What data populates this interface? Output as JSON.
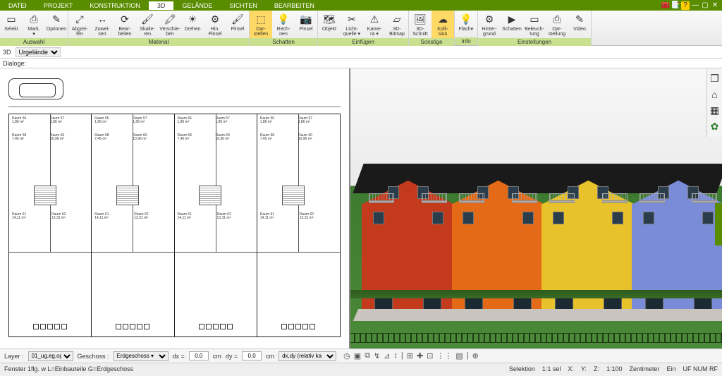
{
  "menu": {
    "tabs": [
      "DATEI",
      "PROJEKT",
      "KONSTRUKTION",
      "3D",
      "GELÄNDE",
      "SICHTEN",
      "BEARBEITEN"
    ],
    "active_index": 3
  },
  "ribbon": {
    "groups": [
      {
        "label": "Auswahl",
        "items": [
          {
            "l1": "Selekt",
            "l2": ""
          },
          {
            "l1": "Mark.",
            "l2": "▾"
          },
          {
            "l1": "Optionen",
            "l2": ""
          }
        ]
      },
      {
        "label": "Material",
        "items": [
          {
            "l1": "Abgrei-",
            "l2": "fen"
          },
          {
            "l1": "Zuwei-",
            "l2": "sen"
          },
          {
            "l1": "Bear-",
            "l2": "beiten"
          },
          {
            "l1": "Skalie-",
            "l2": "ren"
          },
          {
            "l1": "Verschie-",
            "l2": "ben"
          },
          {
            "l1": "Drehen",
            "l2": ""
          },
          {
            "l1": "Hin.",
            "l2": "Pinsel"
          },
          {
            "l1": "Pinsel",
            "l2": ""
          }
        ]
      },
      {
        "label": "Schatten",
        "items": [
          {
            "l1": "Dar-",
            "l2": "stellen",
            "hl": true
          },
          {
            "l1": "Rech-",
            "l2": "nen"
          },
          {
            "l1": "Pinsel",
            "l2": ""
          }
        ]
      },
      {
        "label": "Einfügen",
        "items": [
          {
            "l1": "Objekt",
            "l2": ""
          },
          {
            "l1": "Licht-",
            "l2": "quelle ▾"
          },
          {
            "l1": "Kame-",
            "l2": "ra ▾"
          },
          {
            "l1": "3D-",
            "l2": "Bitmap"
          }
        ]
      },
      {
        "label": "Sonstige",
        "items": [
          {
            "l1": "3D-",
            "l2": "Schnitt"
          },
          {
            "l1": "Kolli-",
            "l2": "sion",
            "hl": true
          }
        ]
      },
      {
        "label": "Info",
        "items": [
          {
            "l1": "Fläche",
            "l2": ""
          }
        ]
      },
      {
        "label": "Einstellungen",
        "items": [
          {
            "l1": "Hinter-",
            "l2": "grund"
          },
          {
            "l1": "Schatten",
            "l2": ""
          },
          {
            "l1": "Beleuch-",
            "l2": "tung"
          },
          {
            "l1": "Dar-",
            "l2": "stellung"
          },
          {
            "l1": "Video",
            "l2": ""
          }
        ]
      }
    ]
  },
  "subbar": {
    "label_3d": "3D",
    "dropdown": "Urgelände"
  },
  "dialoge_label": "Dialoge:",
  "plan": {
    "units": [
      {
        "rooms": [
          {
            "n": "Raum 56",
            "a": "1,86 m²"
          },
          {
            "n": "Raum 57",
            "a": "1,86 m²"
          },
          {
            "n": "Raum 58",
            "a": "7,45 m²"
          },
          {
            "n": "Raum 60",
            "a": "10,96 m²"
          },
          {
            "n": "Raum 61",
            "a": "14,11 m²"
          },
          {
            "n": "Raum 62",
            "a": "13,31 m²"
          }
        ]
      },
      {
        "rooms": [
          {
            "n": "Raum 56",
            "a": "1,86 m²"
          },
          {
            "n": "Raum 57",
            "a": "1,86 m²"
          },
          {
            "n": "Raum 58",
            "a": "7,45 m²"
          },
          {
            "n": "Raum 60",
            "a": "10,96 m²"
          },
          {
            "n": "Raum 61",
            "a": "14,11 m²"
          },
          {
            "n": "Raum 62",
            "a": "13,31 m²"
          }
        ]
      },
      {
        "rooms": [
          {
            "n": "Raum 56",
            "a": "1,86 m²"
          },
          {
            "n": "Raum 57",
            "a": "1,86 m²"
          },
          {
            "n": "Raum 58",
            "a": "7,45 m²"
          },
          {
            "n": "Raum 60",
            "a": "10,96 m²"
          },
          {
            "n": "Raum 61",
            "a": "14,11 m²"
          },
          {
            "n": "Raum 62",
            "a": "13,31 m²"
          }
        ]
      },
      {
        "rooms": [
          {
            "n": "Raum 56",
            "a": "1,86 m²"
          },
          {
            "n": "Raum 57",
            "a": "1,86 m²"
          },
          {
            "n": "Raum 58",
            "a": "7,45 m²"
          },
          {
            "n": "Raum 60",
            "a": "10,96 m²"
          },
          {
            "n": "Raum 61",
            "a": "14,11 m²"
          },
          {
            "n": "Raum 62",
            "a": "13,31 m²"
          }
        ]
      }
    ]
  },
  "houses": [
    {
      "c": "h-red"
    },
    {
      "c": "h-orange"
    },
    {
      "c": "h-yellow"
    },
    {
      "c": "h-blue"
    }
  ],
  "ctrl": {
    "layer_label": "Layer :",
    "layer_val": "01_ug,eg,og",
    "geschoss_label": "Geschoss :",
    "geschoss_val": "Erdgeschoss ▾",
    "dx_label": "dx =",
    "dx_val": "0.0",
    "dx_unit": "cm",
    "dy_label": "dy =",
    "dy_val": "0.0",
    "dy_unit": "cm",
    "mode": "dx,dy (relativ ka"
  },
  "status": {
    "left": "Fenster 1flg. w L=Einbauteile G=Erdgeschoss",
    "selektion": "Selektion",
    "sel": "1:1 sel",
    "x": "X:",
    "y": "Y:",
    "z": "Z:",
    "scale": "1:100",
    "unit": "Zentimeter",
    "ein": "Ein",
    "uf": "UF NUM RF"
  }
}
